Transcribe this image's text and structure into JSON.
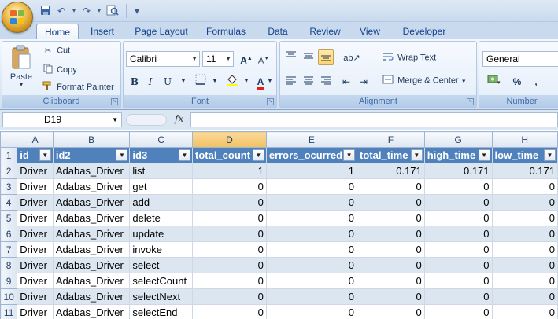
{
  "quick_access": {
    "save_icon": "save-icon",
    "undo_icon": "undo-icon",
    "redo_icon": "redo-icon",
    "print_preview_icon": "print-preview-icon",
    "customize_icon": "customize-icon"
  },
  "tabs": [
    "Home",
    "Insert",
    "Page Layout",
    "Formulas",
    "Data",
    "Review",
    "View",
    "Developer"
  ],
  "ribbon": {
    "clipboard": {
      "label": "Clipboard",
      "paste": "Paste",
      "cut": "Cut",
      "copy": "Copy",
      "format_painter": "Format Painter"
    },
    "font": {
      "label": "Font",
      "name": "Calibri",
      "size": "11",
      "bold": "B",
      "italic": "I",
      "underline": "U"
    },
    "alignment": {
      "label": "Alignment",
      "wrap_text": "Wrap Text",
      "merge_center": "Merge & Center"
    },
    "number": {
      "label": "Number",
      "format": "General",
      "percent": "%",
      "comma": ","
    }
  },
  "formula_bar": {
    "name_box": "D19",
    "fx": "fx",
    "value": ""
  },
  "columns": [
    "A",
    "B",
    "C",
    "D",
    "E",
    "F",
    "G",
    "H"
  ],
  "selected_column": "D",
  "headers": [
    "id",
    "id2",
    "id3",
    "total_count",
    "errors_ocurred",
    "total_time",
    "high_time",
    "low_time"
  ],
  "rows": [
    {
      "n": "1"
    },
    {
      "n": "2",
      "cells": [
        "Driver",
        "Adabas_Driver",
        "list",
        "1",
        "1",
        "0.171",
        "0.171",
        "0.171"
      ]
    },
    {
      "n": "3",
      "cells": [
        "Driver",
        "Adabas_Driver",
        "get",
        "0",
        "0",
        "0",
        "0",
        "0"
      ]
    },
    {
      "n": "4",
      "cells": [
        "Driver",
        "Adabas_Driver",
        "add",
        "0",
        "0",
        "0",
        "0",
        "0"
      ]
    },
    {
      "n": "5",
      "cells": [
        "Driver",
        "Adabas_Driver",
        "delete",
        "0",
        "0",
        "0",
        "0",
        "0"
      ]
    },
    {
      "n": "6",
      "cells": [
        "Driver",
        "Adabas_Driver",
        "update",
        "0",
        "0",
        "0",
        "0",
        "0"
      ]
    },
    {
      "n": "7",
      "cells": [
        "Driver",
        "Adabas_Driver",
        "invoke",
        "0",
        "0",
        "0",
        "0",
        "0"
      ]
    },
    {
      "n": "8",
      "cells": [
        "Driver",
        "Adabas_Driver",
        "select",
        "0",
        "0",
        "0",
        "0",
        "0"
      ]
    },
    {
      "n": "9",
      "cells": [
        "Driver",
        "Adabas_Driver",
        "selectCount",
        "0",
        "0",
        "0",
        "0",
        "0"
      ]
    },
    {
      "n": "10",
      "cells": [
        "Driver",
        "Adabas_Driver",
        "selectNext",
        "0",
        "0",
        "0",
        "0",
        "0"
      ]
    },
    {
      "n": "11",
      "cells": [
        "Driver",
        "Adabas_Driver",
        "selectEnd",
        "0",
        "0",
        "0",
        "0",
        "0"
      ]
    }
  ],
  "colors": {
    "header_fill": "#4f81bd",
    "band_fill": "#dce6f1",
    "selection": "#f1c15f"
  }
}
